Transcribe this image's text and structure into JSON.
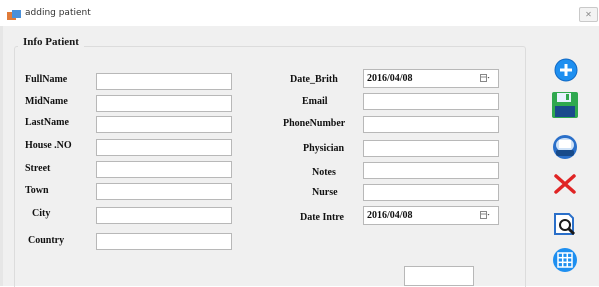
{
  "window": {
    "title": "adding patient",
    "close_glyph": "✕"
  },
  "group": {
    "title": "Info Patient"
  },
  "left_labels": [
    "FullName",
    "MidName",
    "LastName",
    "House .NO",
    "Street",
    "Town",
    "City",
    "Country"
  ],
  "right_labels": [
    "Date_Brith",
    "Email",
    "PhoneNumber",
    "Physician",
    "Notes",
    "Nurse",
    "Date Intre"
  ],
  "dates": {
    "birth": "2016/04/08",
    "intre": "2016/04/08"
  },
  "buttons": [
    "add-icon",
    "save-icon",
    "print-icon",
    "delete-icon",
    "search-icon",
    "grid-icon"
  ]
}
